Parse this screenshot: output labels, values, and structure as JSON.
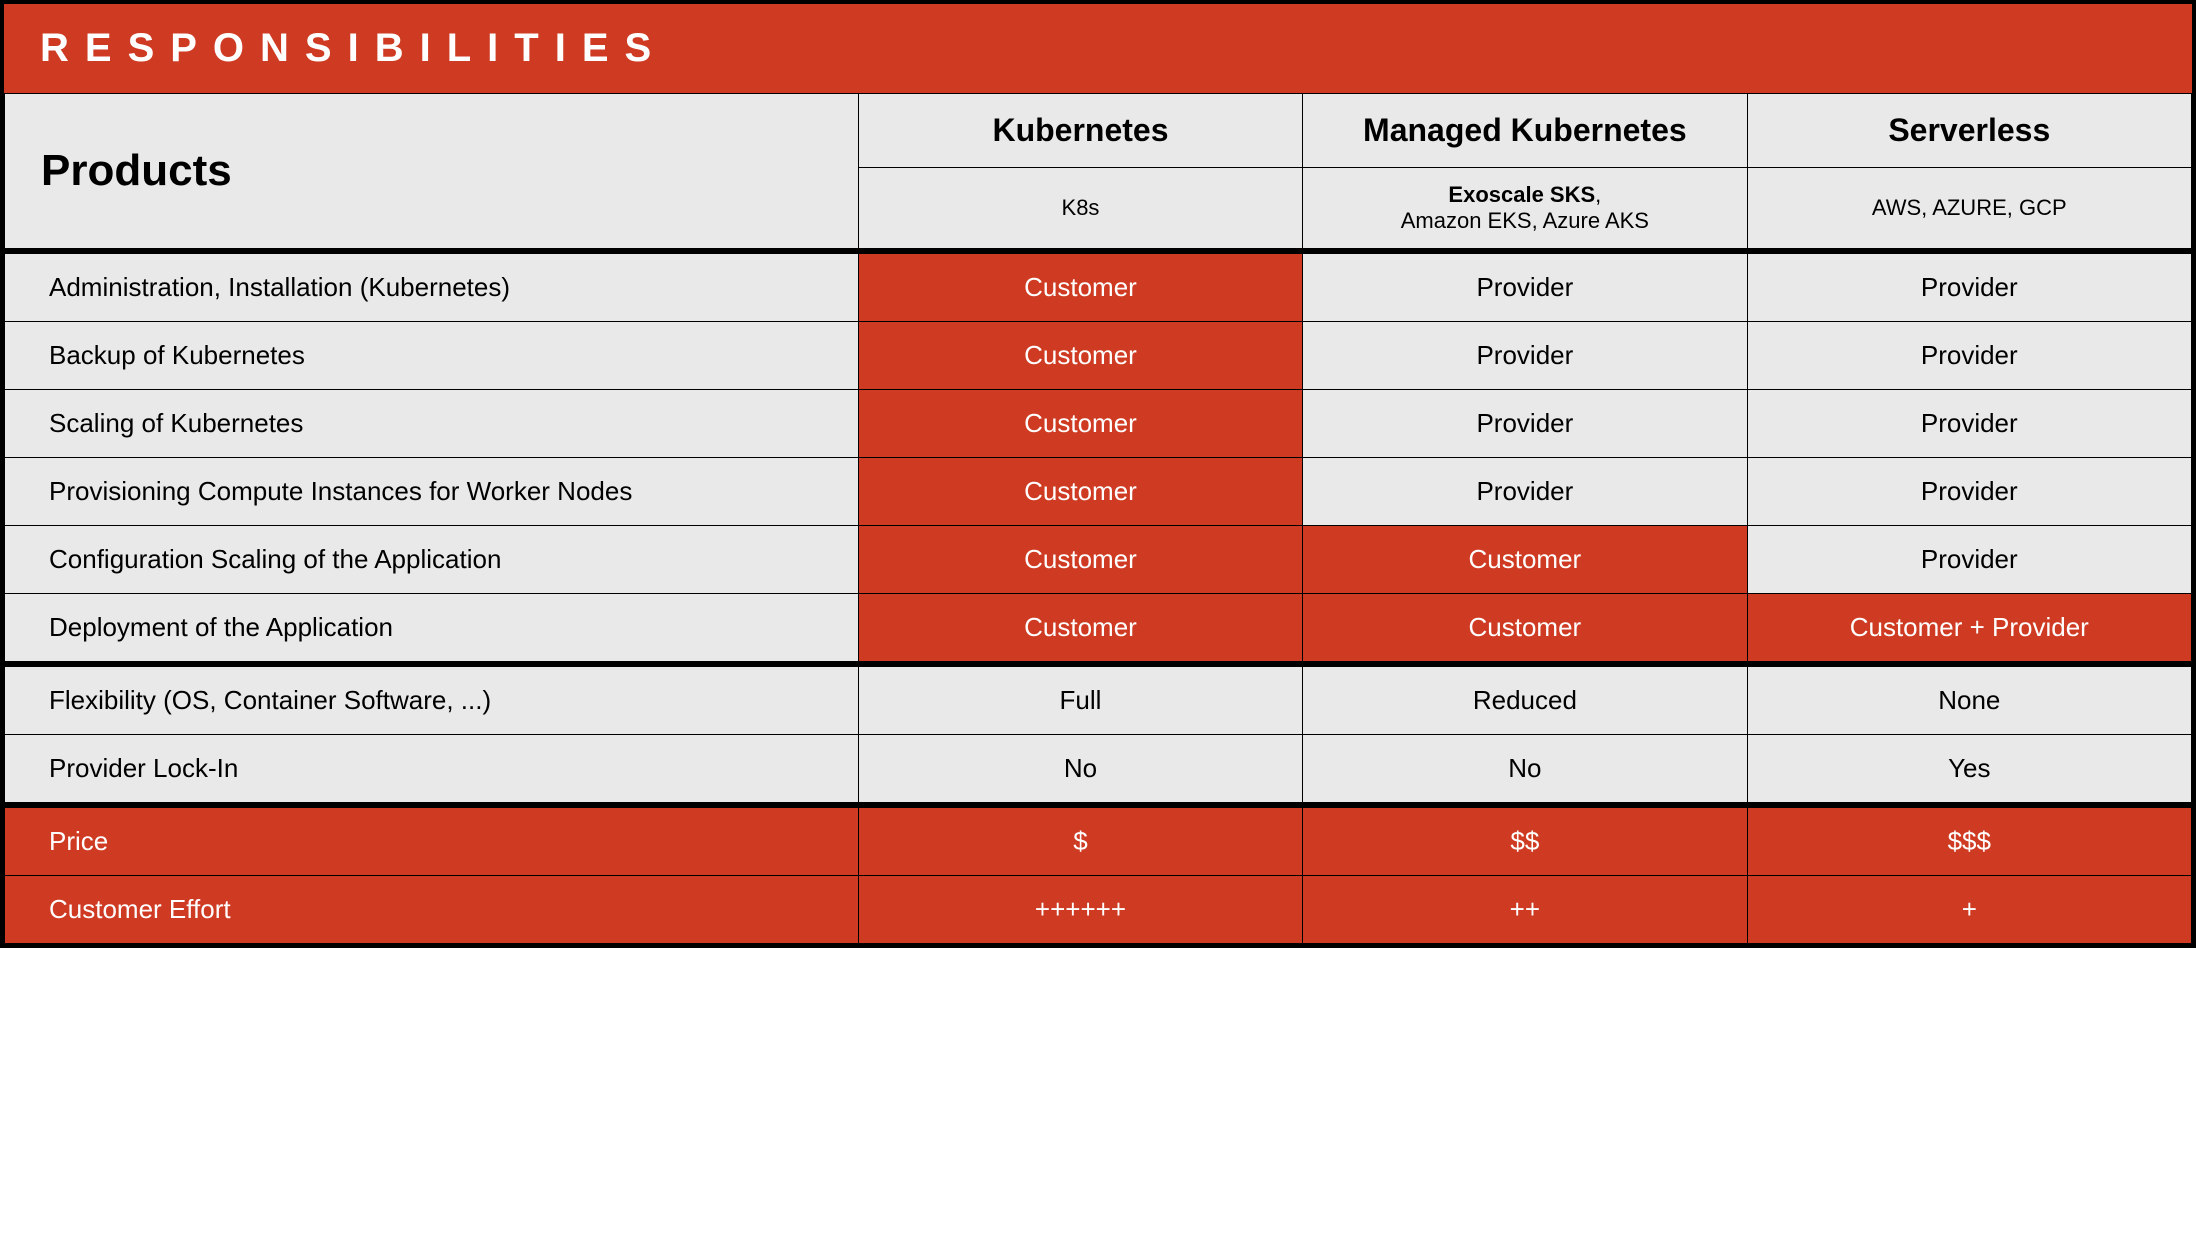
{
  "title": "RESPONSIBILITIES",
  "header": {
    "products": "Products",
    "col1": "Kubernetes",
    "col2": "Managed Kubernetes",
    "col3": "Serverless",
    "sub1": "K8s",
    "sub2a": "Exoscale SKS",
    "sub2b": "Amazon EKS, Azure AKS",
    "sub3": "AWS, AZURE, GCP"
  },
  "rows": {
    "r0": {
      "label": "Administration, Installation (Kubernetes)",
      "c1": "Customer",
      "c2": "Provider",
      "c3": "Provider"
    },
    "r1": {
      "label": "Backup of Kubernetes",
      "c1": "Customer",
      "c2": "Provider",
      "c3": "Provider"
    },
    "r2": {
      "label": "Scaling of Kubernetes",
      "c1": "Customer",
      "c2": "Provider",
      "c3": "Provider"
    },
    "r3": {
      "label": "Provisioning Compute Instances for Worker Nodes",
      "c1": "Customer",
      "c2": "Provider",
      "c3": "Provider"
    },
    "r4": {
      "label": "Configuration Scaling of the Application",
      "c1": "Customer",
      "c2": "Customer",
      "c3": "Provider"
    },
    "r5": {
      "label": "Deployment of the Application",
      "c1": "Customer",
      "c2": "Customer",
      "c3": "Customer + Provider"
    },
    "r6": {
      "label": "Flexibility (OS, Container Software, ...)",
      "c1": "Full",
      "c2": "Reduced",
      "c3": "None"
    },
    "r7": {
      "label": "Provider Lock-In",
      "c1": "No",
      "c2": "No",
      "c3": "Yes"
    },
    "r8": {
      "label": "Price",
      "c1": "$",
      "c2": "$$",
      "c3": "$$$"
    },
    "r9": {
      "label": "Customer Effort",
      "c1": "++++++",
      "c2": "++",
      "c3": "+"
    }
  }
}
